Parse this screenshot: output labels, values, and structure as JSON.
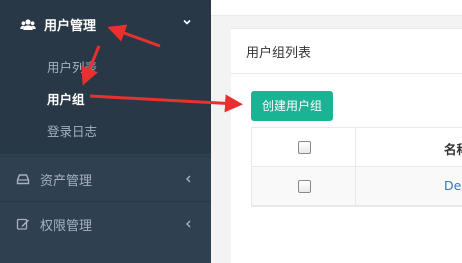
{
  "sidebar": {
    "section": {
      "label": "用户管理",
      "icon": "users-icon",
      "expanded": true,
      "items": [
        {
          "label": "用户列表"
        },
        {
          "label": "用户组",
          "active": true
        },
        {
          "label": "登录日志"
        }
      ]
    },
    "items": [
      {
        "label": "资产管理",
        "icon": "hdd-icon"
      },
      {
        "label": "权限管理",
        "icon": "edit-icon"
      }
    ]
  },
  "panel": {
    "title": "用户组列表",
    "create_button": "创建用户组"
  },
  "table": {
    "columns": [
      "名称"
    ],
    "rows": [
      {
        "name": "De"
      }
    ]
  },
  "colors": {
    "sidebar": "#2f4050",
    "sidebar_active": "#293846",
    "accent": "#1ab394",
    "annotation": "#e8312f",
    "link": "#337ab7"
  }
}
